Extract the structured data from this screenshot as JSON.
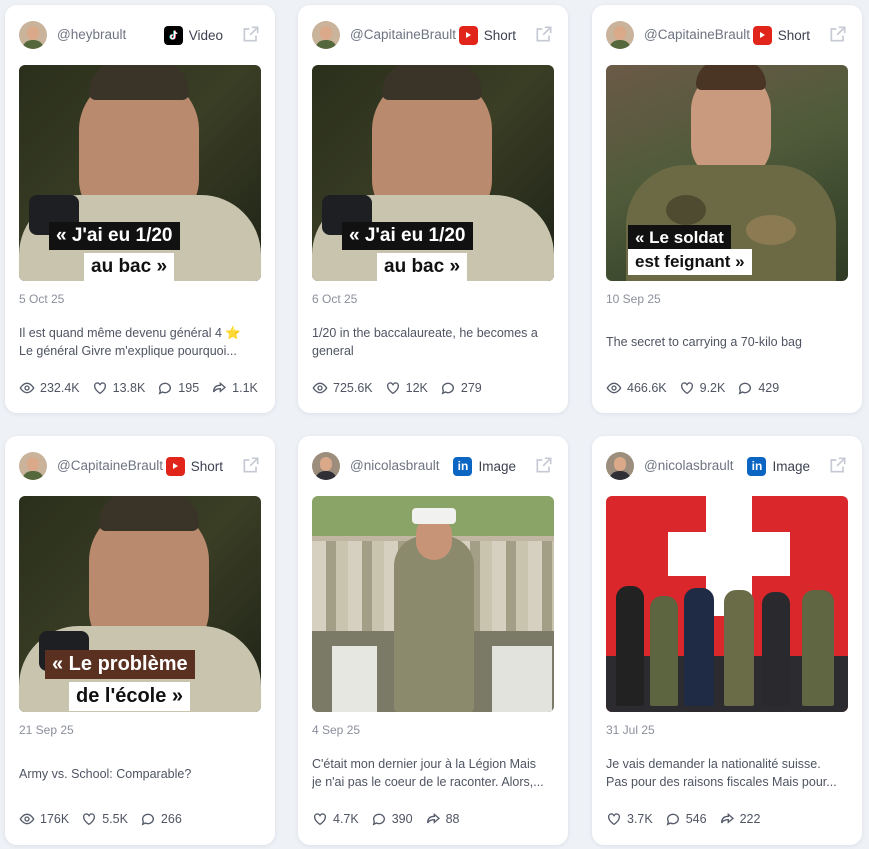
{
  "cards": [
    {
      "handle": "@heybrault",
      "platform": "Video",
      "platform_type": "tiktok",
      "overlay": [
        "« J'ai eu 1/20",
        "au bac »"
      ],
      "date": "5 Oct 25",
      "caption": [
        "Il est quand même devenu général 4 ⭐",
        "Le général Givre m'explique pourquoi..."
      ],
      "stats": {
        "views": "232.4K",
        "likes": "13.8K",
        "comments": "195",
        "shares": "1.1K"
      }
    },
    {
      "handle": "@CapitaineBrault",
      "platform": "Short",
      "platform_type": "youtube",
      "overlay": [
        "« J'ai eu 1/20",
        "au bac »"
      ],
      "date": "6 Oct 25",
      "caption": [
        "1/20 in the baccalaureate, he becomes a",
        "general"
      ],
      "stats": {
        "views": "725.6K",
        "likes": "12K",
        "comments": "279"
      }
    },
    {
      "handle": "@CapitaineBrault",
      "platform": "Short",
      "platform_type": "youtube",
      "overlay": [
        "« Le soldat",
        "est feignant »"
      ],
      "date": "10 Sep 25",
      "caption": [
        "The secret to carrying a 70-kilo bag"
      ],
      "stats": {
        "views": "466.6K",
        "likes": "9.2K",
        "comments": "429"
      }
    },
    {
      "handle": "@CapitaineBrault",
      "platform": "Short",
      "platform_type": "youtube",
      "overlay": [
        "« Le problème",
        "de l'école »"
      ],
      "date": "21 Sep 25",
      "caption": [
        "Army vs. School: Comparable?"
      ],
      "stats": {
        "views": "176K",
        "likes": "5.5K",
        "comments": "266"
      }
    },
    {
      "handle": "@nicolasbrault",
      "platform": "Image",
      "platform_type": "linkedin",
      "overlay": [],
      "date": "4 Sep 25",
      "caption": [
        "C'était mon dernier jour à la Légion Mais",
        "je n'ai pas le coeur de le raconter. Alors,..."
      ],
      "stats": {
        "likes": "4.7K",
        "comments": "390",
        "shares": "88"
      }
    },
    {
      "handle": "@nicolasbrault",
      "platform": "Image",
      "platform_type": "linkedin",
      "overlay": [],
      "date": "31 Jul 25",
      "caption": [
        "Je vais demander la nationalité suisse.",
        "Pas pour des raisons fiscales Mais pour..."
      ],
      "stats": {
        "likes": "3.7K",
        "comments": "546",
        "shares": "222"
      }
    }
  ],
  "colors": {
    "youtube": "#e1251b",
    "linkedin": "#0a66c2",
    "tiktok": "#000000",
    "accent_text": "#4f5462"
  }
}
